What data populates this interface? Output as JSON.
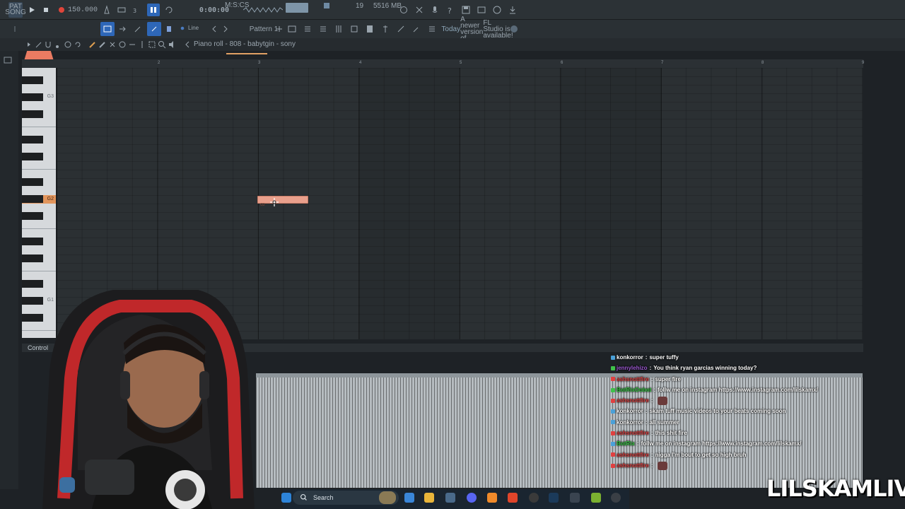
{
  "toolbar": {
    "pat_mode": "PAT",
    "song_mode": "SONG",
    "tempo": "150.000",
    "time_display": "0:00:00",
    "time_label": "M:S:CS",
    "cpu": "19",
    "memory": "5516 MB",
    "pattern_name": "Pattern 1",
    "tool_mode": "Line",
    "news_prefix": "Today",
    "news_text_1": "A newer version of",
    "news_text_2": "FL Studio is available!"
  },
  "piano_roll": {
    "title": "Piano roll - 808 - babytgin - sony",
    "ruler_marks": [
      "2",
      "3",
      "4",
      "5",
      "6",
      "7",
      "8",
      "9"
    ],
    "key_labels": [
      "G3",
      "G2",
      "G1"
    ],
    "selected_key": "G2",
    "note_label": "G2",
    "control_label": "Control"
  },
  "chat": [
    {
      "user": "konkorror",
      "user_color": "#ffffff",
      "badge": "#4aa0d8",
      "message": "super tuffy",
      "emote": false
    },
    {
      "user": "jennylehizo",
      "user_color": "#9b59d0",
      "badge": "#3fc14a",
      "message": "You think ryan garcias winning today?",
      "emote": false
    },
    {
      "user": "ashsnottfire",
      "user_color": "#d83a3a",
      "badge": "#e04040",
      "message": "super fire",
      "emote": false
    },
    {
      "user": "BotRixOobot",
      "user_color": "#2fbf3a",
      "badge": "#3fc14a",
      "message": "follw me on instagram https://www.instagram.com/lilskamx/",
      "emote": false
    },
    {
      "user": "ashsnottfire",
      "user_color": "#d83a3a",
      "badge": "#e04040",
      "message": "",
      "emote": true
    },
    {
      "user": "konkorror",
      "user_color": "#ffffff",
      "badge": "#4aa0d8",
      "message": "skam tuff music videos to your beats coming soon",
      "emote": false
    },
    {
      "user": "konkorror",
      "user_color": "#ffffff",
      "badge": "#4aa0d8",
      "message": "all summer",
      "emote": false
    },
    {
      "user": "ashsnottfire",
      "user_color": "#d83a3a",
      "badge": "#e04040",
      "message": "this shit fire",
      "emote": false
    },
    {
      "user": "BotRix",
      "user_color": "#2fbf3a",
      "badge": "#4aa0d8",
      "message": "follw me on instagram https://www.instagram.com/lilskamx/",
      "emote": false
    },
    {
      "user": "ashsnottfire",
      "user_color": "#d83a3a",
      "badge": "#e04040",
      "message": "nigga I'm bout to get so high bruh",
      "emote": false
    },
    {
      "user": "ashsnottfire",
      "user_color": "#d83a3a",
      "badge": "#e04040",
      "message": "",
      "emote": true
    }
  ],
  "taskbar": {
    "search_label": "Search"
  },
  "overlay": {
    "brand": "LILSKAMLIVE"
  },
  "colors": {
    "note": "#e9a08c",
    "selected_key": "#e2955c",
    "accent": "#2e67b8",
    "record": "#e0453a"
  }
}
